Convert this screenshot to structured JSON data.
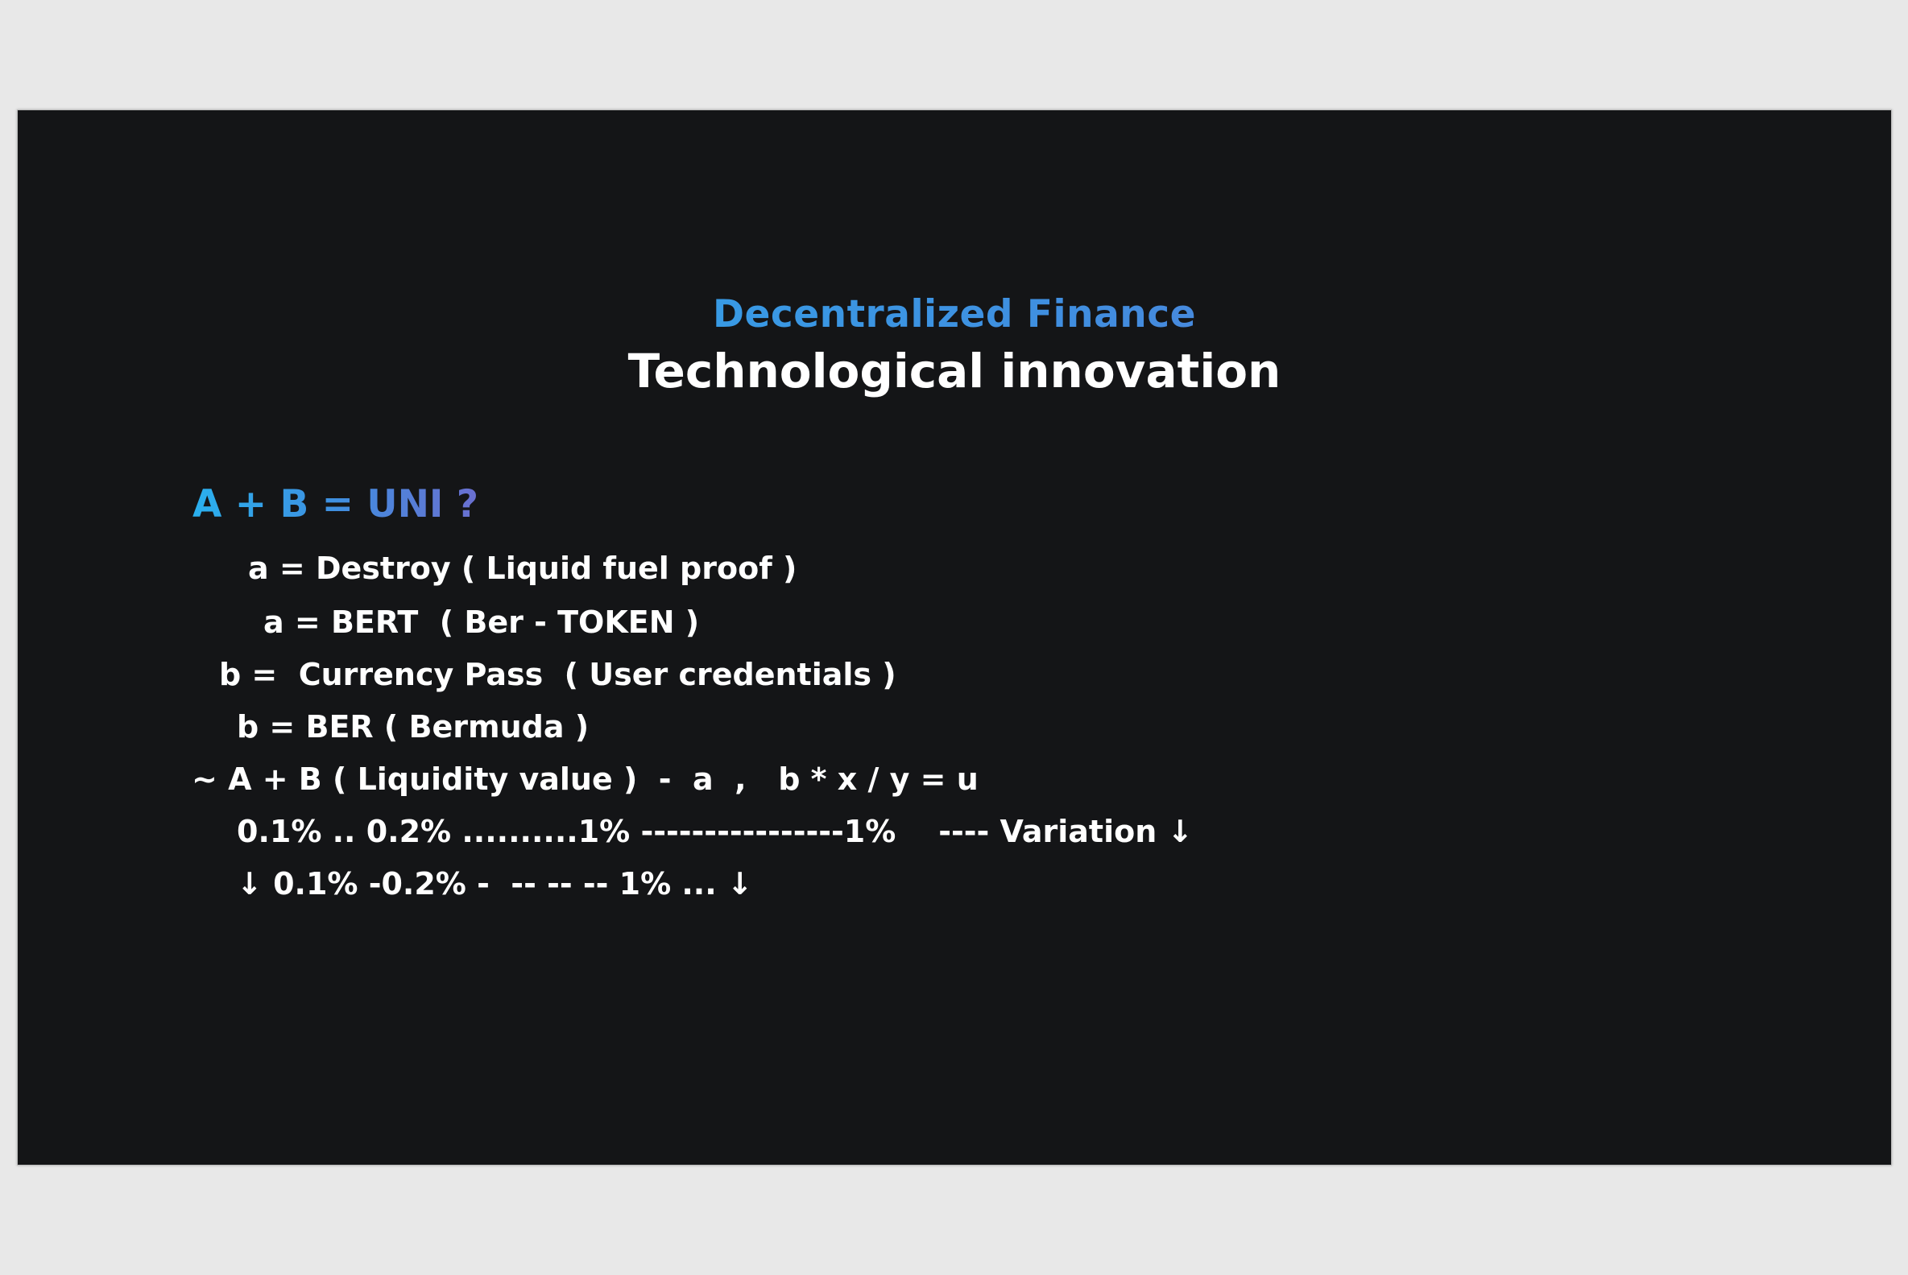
{
  "slide": {
    "subtitle": "Decentralized Finance",
    "title": "Technological innovation",
    "equation": "A + B = UNI ?",
    "lines": [
      "a = Destroy ( Liquid fuel proof )",
      "a = BERT  ( Ber - TOKEN )",
      "b =  Currency Pass  ( User credentials )",
      "b = BER ( Bermuda )",
      "~ A + B ( Liquidity value )  -  a  ,   b * x / y = u",
      "0.1% .. 0.2% ..........1% ----------------1%    ---- Variation ↓",
      "↓ 0.1% -0.2% -  -- -- -- 1% ... ↓"
    ]
  },
  "colors": {
    "slide_background": "#141517",
    "window_background": "#e8e8e8",
    "accent_gradient_start": "#2ab0ee",
    "accent_gradient_end": "#6a6fd0",
    "text": "#ffffff"
  }
}
